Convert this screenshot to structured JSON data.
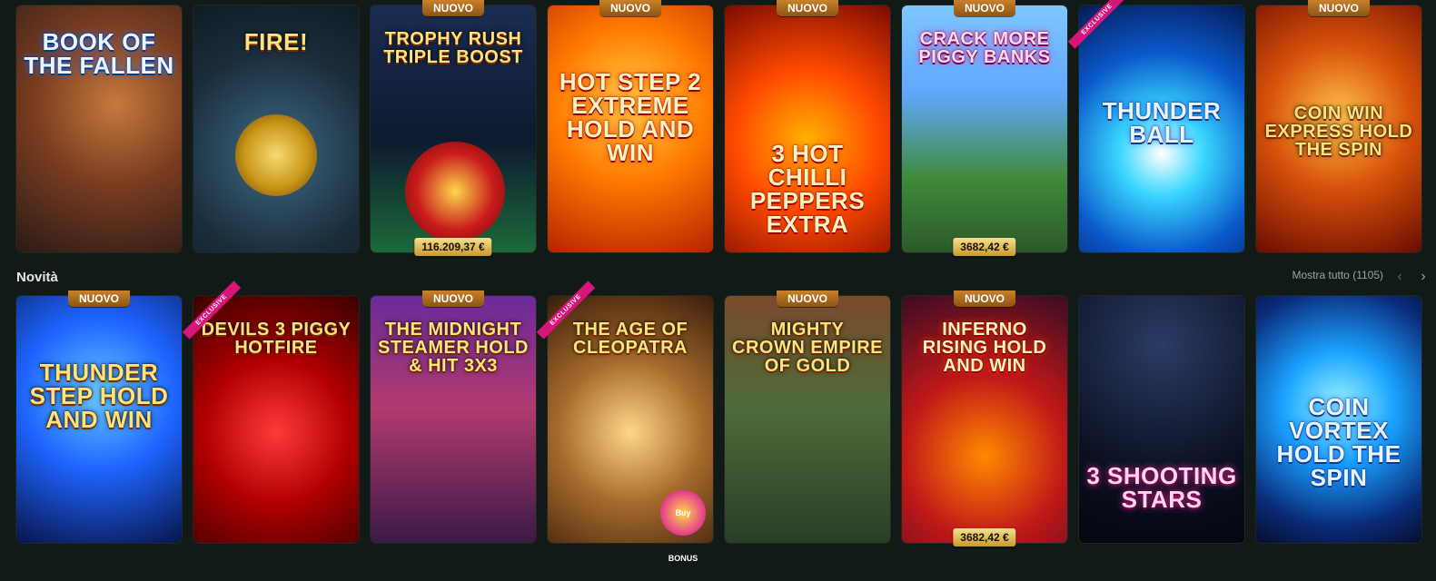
{
  "badges": {
    "new": "NUOVO",
    "exclusive": "EXCLUSIVE"
  },
  "section": {
    "title": "Novità",
    "show_all": "Mostra tutto (1105)"
  },
  "row1": [
    {
      "title": "BOOK OF THE FALLEN",
      "new": false,
      "exclusive": false,
      "jackpot": ""
    },
    {
      "title": "FIRE!",
      "new": false,
      "exclusive": false,
      "jackpot": ""
    },
    {
      "title": "TROPHY RUSH Triple BOOST",
      "new": true,
      "exclusive": false,
      "jackpot": "116.209,37 €"
    },
    {
      "title": "HOT STEP 2 EXTREME HOLD AND WIN",
      "new": true,
      "exclusive": false,
      "jackpot": ""
    },
    {
      "title": "3 HOT CHILLI PEPPERS EXTRA",
      "new": true,
      "exclusive": false,
      "jackpot": ""
    },
    {
      "title": "CRACK MORE PIGGY BANKS",
      "new": true,
      "exclusive": false,
      "jackpot": "3682,42 €"
    },
    {
      "title": "THUNDER BALL",
      "new": false,
      "exclusive": true,
      "jackpot": ""
    },
    {
      "title": "COIN WIN EXPRESS HOLD THE SPIN",
      "new": true,
      "exclusive": false,
      "jackpot": ""
    }
  ],
  "row2": [
    {
      "title": "THUNDER STEP HOLD AND WIN",
      "new": true,
      "exclusive": false,
      "jackpot": ""
    },
    {
      "title": "DEVILS 3 PIGGY HOTFIRE",
      "new": false,
      "exclusive": true,
      "jackpot": ""
    },
    {
      "title": "THE MIDNIGHT STEAMER HOLD & HIT 3x3",
      "new": true,
      "exclusive": false,
      "jackpot": ""
    },
    {
      "title": "THE AGE OF CLEOPATRA",
      "new": false,
      "exclusive": true,
      "jackpot": ""
    },
    {
      "title": "MIGHTY CROWN EMPIRE OF GOLD",
      "new": true,
      "exclusive": false,
      "jackpot": ""
    },
    {
      "title": "INFERNO RISING HOLD AND WIN",
      "new": true,
      "exclusive": false,
      "jackpot": "3682,42 €"
    },
    {
      "title": "3 SHOOTING STARS",
      "new": false,
      "exclusive": false,
      "jackpot": ""
    },
    {
      "title": "COIN VORTEX HOLD THE SPIN",
      "new": false,
      "exclusive": false,
      "jackpot": ""
    }
  ],
  "extras": {
    "cleopatra_tag": "Buy BONUS"
  }
}
